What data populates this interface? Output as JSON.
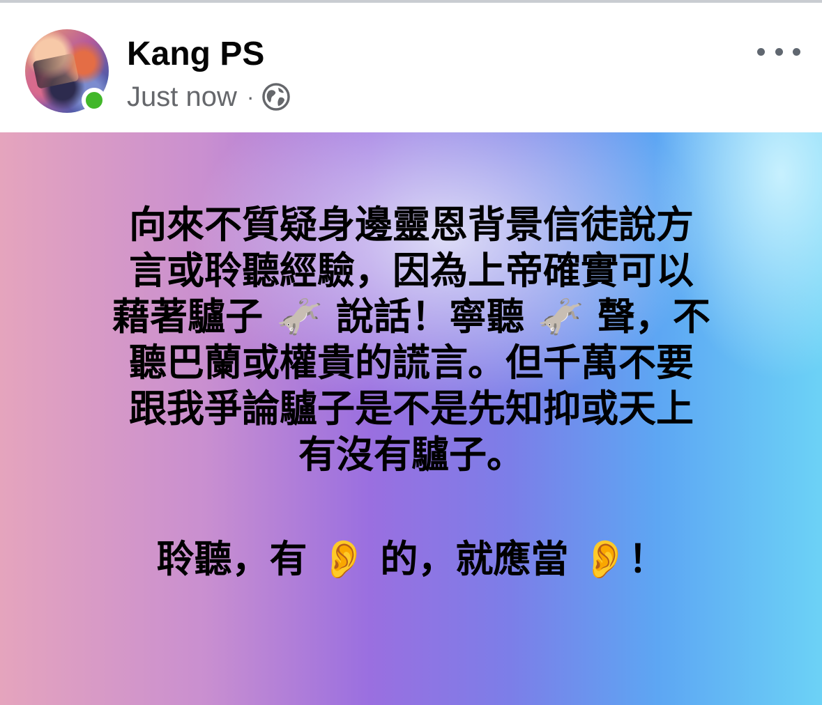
{
  "post": {
    "author": "Kang PS",
    "timestamp": "Just now",
    "separator": "·",
    "privacy_icon": "globe-icon",
    "online": true,
    "more_icon": "more-horizontal-icon",
    "body_paragraph_1": "向來不質疑身邊靈恩背景信徒說方\n言或聆聽經驗，因為上帝確實可以\n藉著驢子 🫏 說話！寧聽 🫏 聲，不\n聽巴蘭或權貴的謊言。但千萬不要\n跟我爭論驢子是不是先知抑或天上\n有沒有驢子。",
    "body_paragraph_2": "聆聽，有 👂 的，就應當 👂！",
    "colors": {
      "online_dot": "#42b72a",
      "meta_text": "#65676b",
      "gradient_left": "#e5a4bd",
      "gradient_mid": "#9a6fe0",
      "gradient_right": "#6cd2f6"
    }
  }
}
